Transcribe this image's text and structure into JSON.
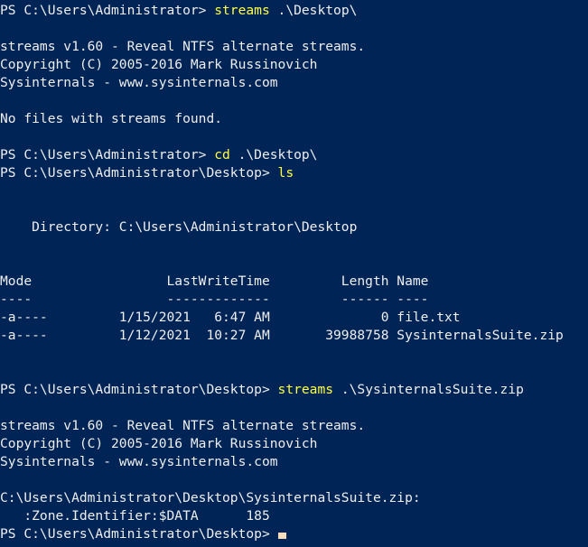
{
  "terminal": {
    "background_color": "#012456",
    "foreground_color": "#eeeeee",
    "command_color": "#ffff45",
    "cursor_color": "#f8dcbc",
    "lines": [
      {
        "id": "prompt-streams-desktop",
        "prompt": "PS C:\\Users\\Administrator> ",
        "command": "streams",
        "args": " .\\Desktop\\"
      },
      {
        "id": "blank-1",
        "text": ""
      },
      {
        "id": "out-banner-1",
        "text": "streams v1.60 - Reveal NTFS alternate streams."
      },
      {
        "id": "out-copyright-1",
        "text": "Copyright (C) 2005-2016 Mark Russinovich"
      },
      {
        "id": "out-sysinternals-1",
        "text": "Sysinternals - www.sysinternals.com"
      },
      {
        "id": "blank-2",
        "text": ""
      },
      {
        "id": "out-nofiles",
        "text": "No files with streams found."
      },
      {
        "id": "blank-3",
        "text": ""
      },
      {
        "id": "prompt-cd",
        "prompt": "PS C:\\Users\\Administrator> ",
        "command": "cd",
        "args": " .\\Desktop\\"
      },
      {
        "id": "prompt-ls",
        "prompt": "PS C:\\Users\\Administrator\\Desktop> ",
        "command": "ls",
        "args": ""
      },
      {
        "id": "blank-4",
        "text": ""
      },
      {
        "id": "blank-5",
        "text": ""
      },
      {
        "id": "out-directory",
        "text": "    Directory: C:\\Users\\Administrator\\Desktop"
      },
      {
        "id": "blank-6",
        "text": ""
      },
      {
        "id": "blank-7",
        "text": ""
      },
      {
        "id": "table-header",
        "text": "Mode                 LastWriteTime         Length Name"
      },
      {
        "id": "table-rule",
        "text": "----                 -------------         ------ ----"
      },
      {
        "id": "table-row-1",
        "text": "-a----         1/15/2021   6:47 AM              0 file.txt"
      },
      {
        "id": "table-row-2",
        "text": "-a----         1/12/2021  10:27 AM       39988758 SysinternalsSuite.zip"
      },
      {
        "id": "blank-8",
        "text": ""
      },
      {
        "id": "blank-9",
        "text": ""
      },
      {
        "id": "prompt-streams-zip",
        "prompt": "PS C:\\Users\\Administrator\\Desktop> ",
        "command": "streams",
        "args": " .\\SysinternalsSuite.zip"
      },
      {
        "id": "blank-10",
        "text": ""
      },
      {
        "id": "out-banner-2",
        "text": "streams v1.60 - Reveal NTFS alternate streams."
      },
      {
        "id": "out-copyright-2",
        "text": "Copyright (C) 2005-2016 Mark Russinovich"
      },
      {
        "id": "out-sysinternals-2",
        "text": "Sysinternals - www.sysinternals.com"
      },
      {
        "id": "blank-11",
        "text": ""
      },
      {
        "id": "out-zip-path",
        "text": "C:\\Users\\Administrator\\Desktop\\SysinternalsSuite.zip:"
      },
      {
        "id": "out-zone-identifier",
        "text": "   :Zone.Identifier:$DATA\t185"
      },
      {
        "id": "prompt-final",
        "prompt": "PS C:\\Users\\Administrator\\Desktop> ",
        "command": "",
        "args": "",
        "cursor": true
      }
    ],
    "directory_listing": {
      "directory": "C:\\Users\\Administrator\\Desktop",
      "columns": [
        "Mode",
        "LastWriteTime",
        "Length",
        "Name"
      ],
      "rows": [
        {
          "mode": "-a----",
          "date": "1/15/2021",
          "time": "6:47 AM",
          "length": "0",
          "name": "file.txt"
        },
        {
          "mode": "-a----",
          "date": "1/12/2021",
          "time": "10:27 AM",
          "length": "39988758",
          "name": "SysinternalsSuite.zip"
        }
      ]
    },
    "streams_output": {
      "version_banner": "streams v1.60 - Reveal NTFS alternate streams.",
      "copyright": "Copyright (C) 2005-2016 Mark Russinovich",
      "publisher": "Sysinternals - www.sysinternals.com",
      "no_files_message": "No files with streams found.",
      "target_file": "C:\\Users\\Administrator\\Desktop\\SysinternalsSuite.zip:",
      "stream_name": ":Zone.Identifier:$DATA",
      "stream_size": "185"
    }
  }
}
